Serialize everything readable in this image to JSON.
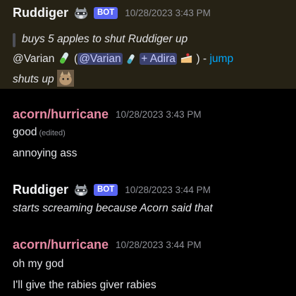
{
  "messages": [
    {
      "author": "Ruddiger",
      "author_color": "#f2f3f5",
      "is_bot": true,
      "badge": "BOT",
      "timestamp": "10/28/2023 3:43 PM",
      "quote": "buys 5 apples to shut Ruddiger up",
      "reply_mention": "@Varian",
      "reply_open_paren": "(",
      "reply_inner_mention": "@Varian",
      "reply_plus": "+ Adira",
      "reply_close": ") -",
      "jump_link": "jump",
      "body": "shuts up"
    },
    {
      "author": "acorn/hurricane",
      "author_color": "#e98ba6",
      "timestamp": "10/28/2023 3:43 PM",
      "line1": "good",
      "edited": "(edited)",
      "line2": "annoying ass"
    },
    {
      "author": "Ruddiger",
      "author_color": "#f2f3f5",
      "is_bot": true,
      "badge": "BOT",
      "timestamp": "10/28/2023 3:44 PM",
      "body": "starts screaming because Acorn said that"
    },
    {
      "author": "acorn/hurricane",
      "author_color": "#e98ba6",
      "timestamp": "10/28/2023 3:44 PM",
      "line1": "oh my god",
      "line2": "I'll give the rabies giver rabies"
    }
  ],
  "colors": {
    "background": "#000000",
    "highlight_background": "#262215",
    "bot_badge": "#5865f2",
    "link": "#00a8fc",
    "mention_bg": "#3c4270"
  },
  "icons": [
    "raccoon-emoji",
    "test-tube-emoji",
    "cake-emoji",
    "cat-sticker"
  ]
}
